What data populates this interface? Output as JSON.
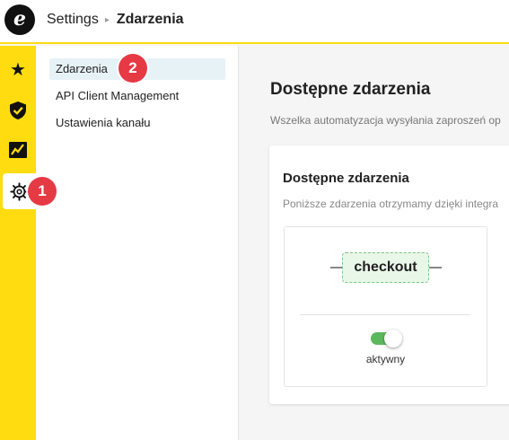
{
  "header": {
    "logo_letter": "e",
    "breadcrumb_root": "Settings",
    "breadcrumb_separator": "▸",
    "breadcrumb_current": "Zdarzenia"
  },
  "rail": {
    "items": [
      {
        "icon": "star-icon"
      },
      {
        "icon": "shield-check-icon"
      },
      {
        "icon": "chart-icon"
      },
      {
        "icon": "gear-icon",
        "active": true
      }
    ]
  },
  "subnav": {
    "items": [
      {
        "label": "Zdarzenia",
        "active": true
      },
      {
        "label": "API Client Management"
      },
      {
        "label": "Ustawienia kanału"
      }
    ]
  },
  "annotations": {
    "badge1": "1",
    "badge2": "2"
  },
  "main": {
    "title": "Dostępne zdarzenia",
    "description": "Wszelka automatyzacja wysyłania zaproszeń op",
    "card": {
      "title": "Dostępne zdarzenia",
      "description": "Poniższe zdarzenia otrzymamy dzięki integra",
      "event": {
        "name": "checkout",
        "toggle_on": true,
        "status_label": "aktywny"
      }
    }
  },
  "colors": {
    "accent_yellow": "#ffdc0f",
    "badge_red": "#e53944",
    "toggle_green": "#5cb85c",
    "active_nav_bg": "#e7f2f7"
  }
}
